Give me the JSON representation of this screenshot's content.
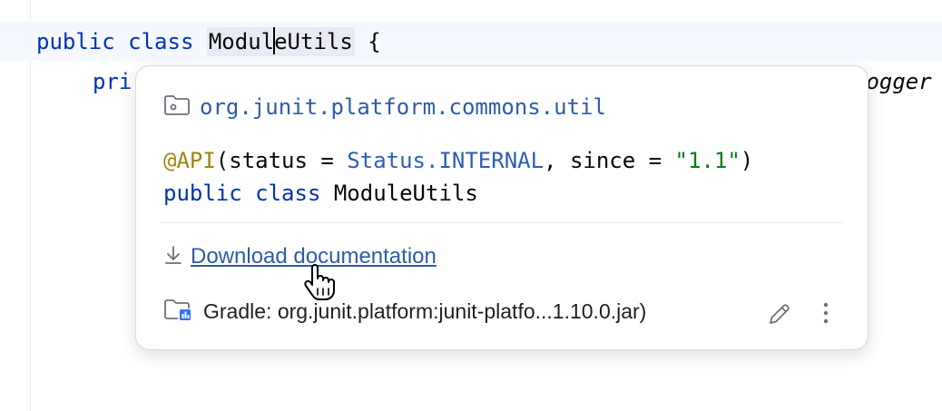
{
  "editor": {
    "line1": {
      "kw_public": "public",
      "kw_class": "class",
      "ident_part1": "Modul",
      "ident_part2": "eUtils",
      "brace": " {"
    },
    "line2_prefix": "pri",
    "line2_suffix": ".ogger"
  },
  "popup": {
    "package": "org.junit.platform.commons.util",
    "signature": {
      "annotation": "@API",
      "paren_open": "(status = ",
      "status_value": "Status.INTERNAL",
      "since_part": ", since = ",
      "since_value": "\"1.1\"",
      "paren_close": ")",
      "kw_public": "public",
      "kw_class": "class",
      "class_name": "ModuleUtils"
    },
    "download_label": "Download documentation",
    "library": "Gradle: org.junit.platform:junit-platfo...1.10.0.jar)"
  },
  "icons": {
    "package": "folder-package-icon",
    "download": "download-icon",
    "library": "library-folder-icon",
    "edit": "pencil-icon",
    "more": "more-vertical-icon",
    "cursor": "hand-cursor-icon"
  },
  "colors": {
    "keyword": "#0033b3",
    "annotation": "#9e880d",
    "string": "#067d17",
    "link": "#2f5ba8"
  }
}
